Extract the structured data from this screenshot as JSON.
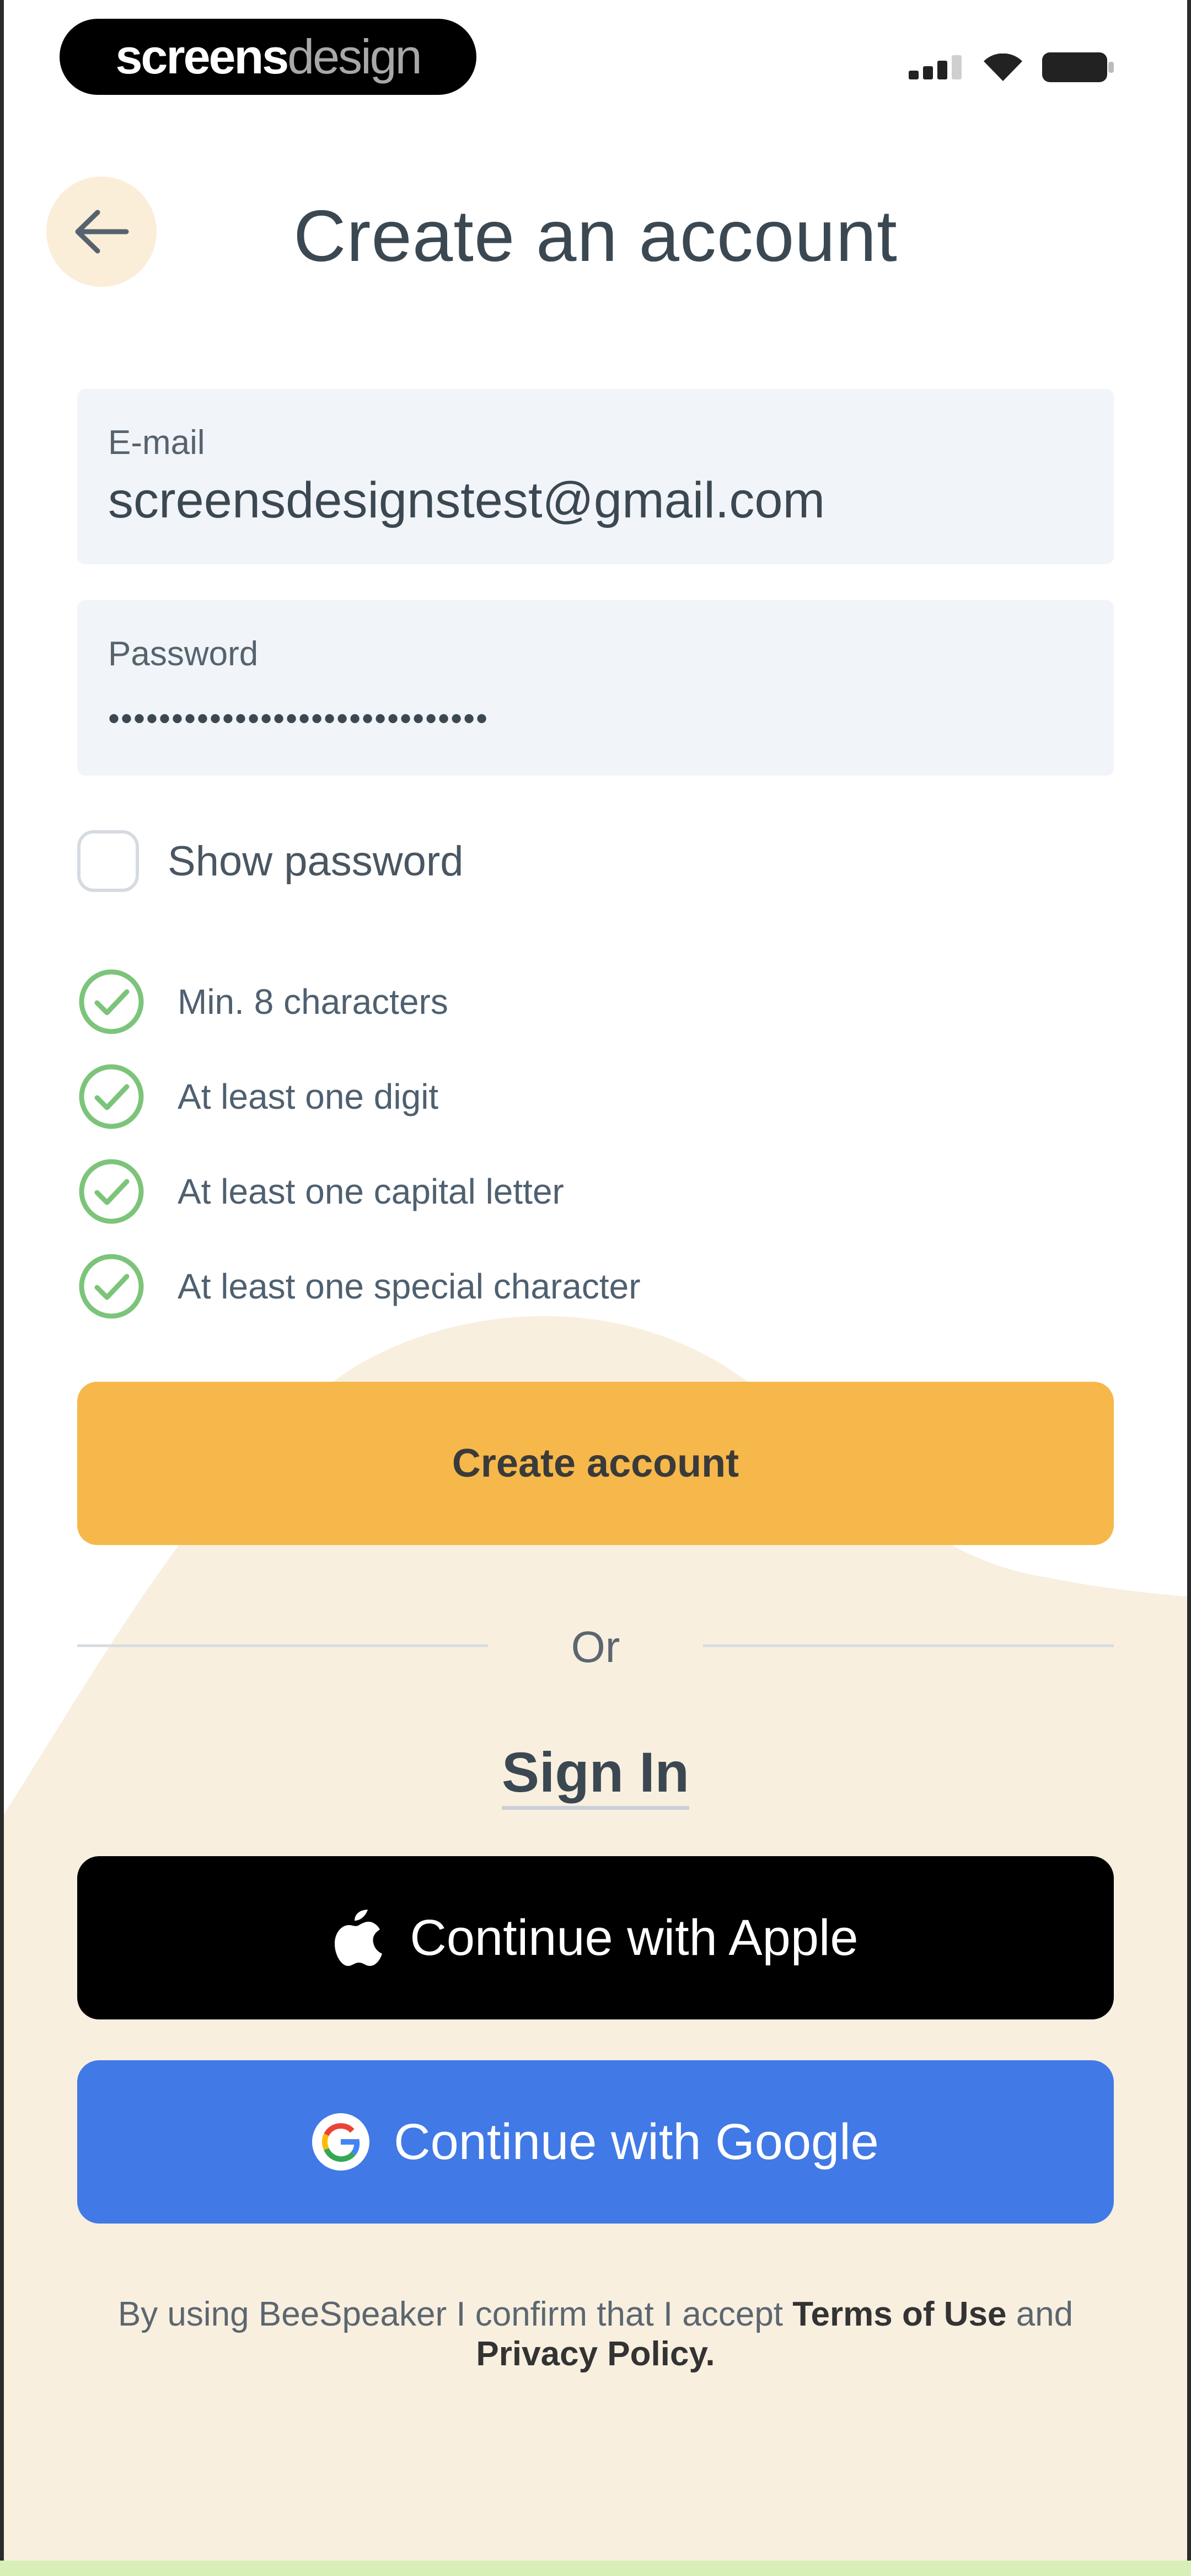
{
  "status_bar": {
    "brand_part_1": "screens",
    "brand_part_2": "design",
    "icons": [
      "signal-icon",
      "wifi-icon",
      "battery-icon"
    ]
  },
  "header": {
    "back_icon": "arrow-left-icon",
    "title": "Create an account"
  },
  "form": {
    "email": {
      "label": "E-mail",
      "value": "screensdesignstest@gmail.com"
    },
    "password": {
      "label": "Password",
      "value": "••••••••••••••••••••••••••••••"
    },
    "show_password_label": "Show password",
    "show_password_checked": false,
    "requirements": [
      {
        "text": "Min. 8 characters",
        "met": true
      },
      {
        "text": "At least one digit",
        "met": true
      },
      {
        "text": "At least one capital letter",
        "met": true
      },
      {
        "text": "At least one special character",
        "met": true
      }
    ]
  },
  "actions": {
    "create_account": "Create account",
    "or": "Or",
    "sign_in": "Sign In",
    "apple": "Continue with Apple",
    "google": "Continue with Google"
  },
  "legal": {
    "prefix": "By using BeeSpeaker I confirm that I accept ",
    "terms": "Terms of Use",
    "and": " and ",
    "privacy": "Privacy Policy",
    "suffix": "."
  },
  "colors": {
    "primary": "#f6b84a",
    "google": "#4179e6",
    "apple": "#000000",
    "success": "#7cc47a",
    "background_shape": "#f8efdf"
  }
}
